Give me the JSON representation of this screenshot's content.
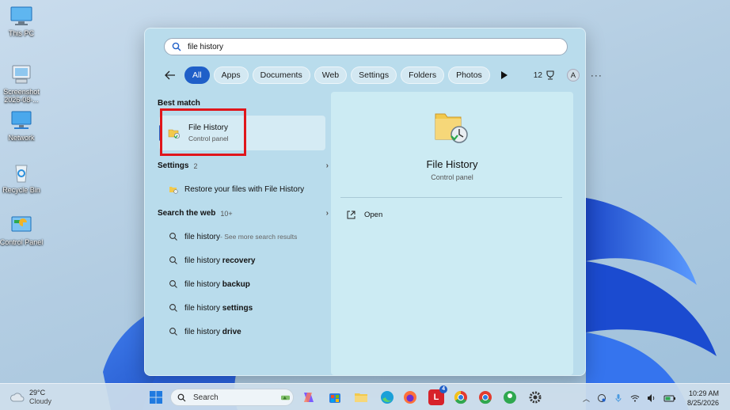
{
  "desktop": {
    "icons": [
      {
        "label_1": "This PC",
        "label_2": ""
      },
      {
        "label_1": "Screenshot",
        "label_2": "2026-08-..."
      },
      {
        "label_1": "Network",
        "label_2": ""
      },
      {
        "label_1": "Recycle Bin",
        "label_2": ""
      },
      {
        "label_1": "Control Panel",
        "label_2": ""
      }
    ]
  },
  "search": {
    "query": "file history"
  },
  "filters": {
    "items": [
      "All",
      "Apps",
      "Documents",
      "Web",
      "Settings",
      "Folders",
      "Photos"
    ],
    "active": "All",
    "count": "12",
    "avatar_letter": "A",
    "more": "···"
  },
  "best_match": {
    "heading": "Best match",
    "title": "File History",
    "subtitle": "Control panel"
  },
  "settings_section": {
    "heading": "Settings",
    "count": "2",
    "item": "Restore your files with File History"
  },
  "web_section": {
    "heading": "Search the web",
    "count": "10+",
    "results": [
      {
        "prefix": "file history",
        "suffix": "",
        "note": " - See more search results"
      },
      {
        "prefix": "file history ",
        "suffix": "recovery",
        "note": ""
      },
      {
        "prefix": "file history ",
        "suffix": "backup",
        "note": ""
      },
      {
        "prefix": "file history ",
        "suffix": "settings",
        "note": ""
      },
      {
        "prefix": "file history ",
        "suffix": "drive",
        "note": ""
      }
    ]
  },
  "detail": {
    "title": "File History",
    "subtitle": "Control panel",
    "action_open": "Open"
  },
  "taskbar": {
    "weather_temp": "29°C",
    "weather_desc": "Cloudy",
    "search_placeholder": "Search",
    "time": "10:29 AM",
    "date": "8/25/2026",
    "mail_badge": "4"
  },
  "colors": {
    "accent": "#1f5fc8",
    "highlight_box": "#e0161b"
  }
}
